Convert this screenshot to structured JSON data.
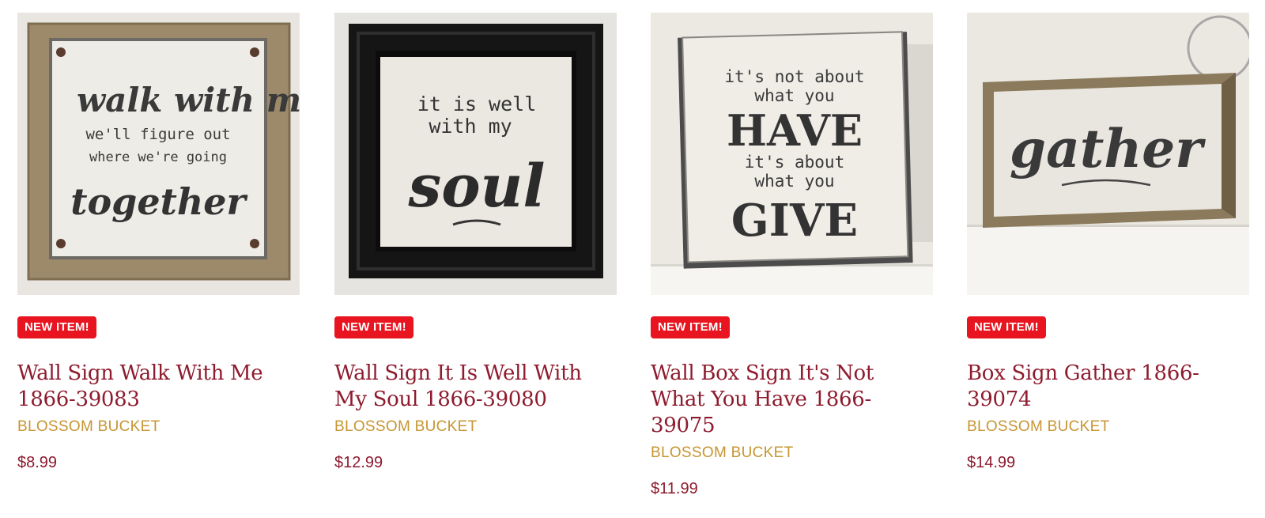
{
  "colors": {
    "title": "#8e1b2e",
    "brand": "#c69532",
    "price": "#8e1b2e",
    "badge_bg": "#e8141f",
    "badge_text": "#ffffff"
  },
  "products": [
    {
      "badge": "NEW ITEM!",
      "title": "Wall Sign Walk With Me 1866-39083",
      "brand": "BLOSSOM BUCKET",
      "price": "$8.99",
      "sign_text": [
        "walk with me",
        "we'll figure out",
        "where we're going",
        "together"
      ]
    },
    {
      "badge": "NEW ITEM!",
      "title": "Wall Sign It Is Well With My Soul 1866-39080",
      "brand": "BLOSSOM BUCKET",
      "price": "$12.99",
      "sign_text": [
        "it is well",
        "with my",
        "soul"
      ]
    },
    {
      "badge": "NEW ITEM!",
      "title": "Wall Box Sign It's Not What You Have 1866-39075",
      "brand": "BLOSSOM BUCKET",
      "price": "$11.99",
      "sign_text": [
        "it's not about",
        "what you",
        "HAVE",
        "it's about",
        "what you",
        "GIVE"
      ]
    },
    {
      "badge": "NEW ITEM!",
      "title": "Box Sign Gather 1866-39074",
      "brand": "BLOSSOM BUCKET",
      "price": "$14.99",
      "sign_text": [
        "gather"
      ]
    }
  ]
}
